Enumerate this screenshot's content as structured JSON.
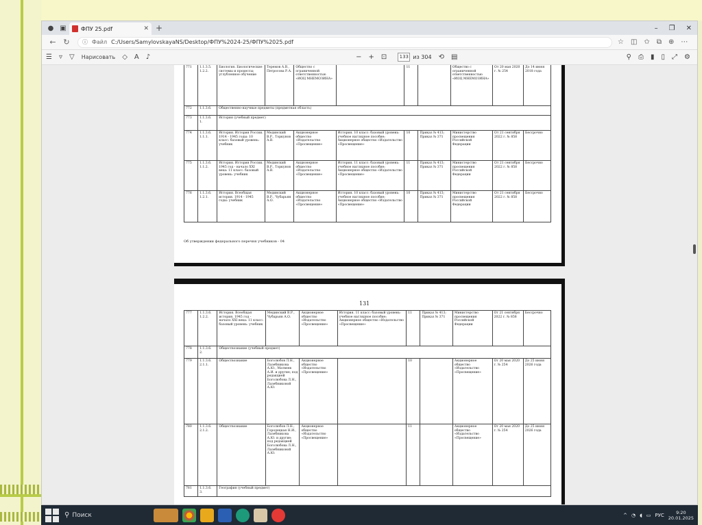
{
  "browser": {
    "tab_title": "ФПУ 25.pdf",
    "new_tab_label": "+",
    "address_label": "Файл",
    "url": "C:/Users/SamylovskayaNS/Desktop/ФПУ%2024-25/ФПУ%2025.pdf"
  },
  "pdf_toolbar": {
    "draw_label": "Нарисовать",
    "page_current": "133",
    "page_total": "из 304"
  },
  "page1": {
    "rows": [
      [
        "771",
        "1.1.3.5. 1.2.2.",
        "Биология. Биологические системы и процессы; углубленное обучение",
        "Теремов А.В., Петросова Р.А.",
        "Общество с ограниченной ответственностью «ИОЦ МНЕМОЗИНА»",
        "",
        "11",
        "",
        "Общество с ограниченной ответственностью «ИОЦ МНЕМОЗИНА»",
        "От 20 мая 2020 г. № 254",
        "До 14 июня 2018 года"
      ],
      [
        "772",
        "1.1.3.6.",
        "Общественно-научные предметы (предметная область)"
      ],
      [
        "773",
        "1.1.3.6. 1.",
        "История (учебный предмет)"
      ],
      [
        "774",
        "1.1.3.6. 1.1.1.",
        "История. История России. 1914 - 1945 годы: 10 класс: базовый уровень: учебник",
        "Мединский В.Р., Торкунов А.В.",
        "Акционерное общество «Издательство «Просвещение»",
        "История. 10 класс: базовый уровень: учебное наглядное пособие; Акционерное общество «Издательство «Просвещение»",
        "10",
        "Приказ № 413; Приказ № 371",
        "Министерство просвещения Российской Федерации",
        "От 21 сентября 2022 г. № 858",
        "Бессрочно"
      ],
      [
        "775",
        "1.1.3.6. 1.1.2.",
        "История. История России. 1945 год - начало XXI века: 11 класс: базовый уровень: учебник",
        "Мединский В.Р., Торкунов А.В.",
        "Акционерное общество «Издательство «Просвещение»",
        "История. 11 класс: базовый уровень: учебное наглядное пособие; Акционерное общество «Издательство «Просвещение»",
        "11",
        "Приказ № 413; Приказ № 371",
        "Министерство просвещения Российской Федерации",
        "От 21 сентября 2022 г. № 858",
        "Бессрочно"
      ],
      [
        "776",
        "1.1.3.6. 1.2.1.",
        "История. Всеобщая история. 1914 - 1945 годы: учебник",
        "Мединский В.Р., Чубарьян А.О.",
        "Акционерное общество «Издательство «Просвещение»",
        "История. 10 класс: базовый уровень: учебное наглядное пособие; Акционерное общество «Издательство «Просвещение»",
        "10",
        "Приказ № 413; Приказ № 371",
        "Министерство просвещения Российской Федерации",
        "От 21 сентября 2022 г. № 858",
        "Бессрочно"
      ]
    ],
    "footer_note": "Об утверждении федерального перечня учебников - 04"
  },
  "page2": {
    "page_number": "131",
    "rows": [
      [
        "777",
        "1.1.3.6. 1.2.2.",
        "История. Всеобщая история. 1945 год - начало XXI века: 11 класс: базовый уровень: учебник",
        "Мединский В.Р., Чубарьян А.О.",
        "Акционерное общество «Издательство «Просвещение»",
        "История. 11 класс: базовый уровень: учебное наглядное пособие; Акционерное общество «Издательство «Просвещение»",
        "11",
        "Приказ № 413; Приказ № 371",
        "Министерство просвещения Российской Федерации",
        "От 21 сентября 2022 г. № 858",
        "Бессрочно"
      ],
      [
        "778",
        "1.1.3.6. 2.",
        "Обществознание (учебный предмет)"
      ],
      [
        "779",
        "1.1.3.6. 2.1.1.",
        "Обществознание",
        "Боголюбов Л.Н., Лазебникова А.Ю., Матвеев А.И. и другие; под редакцией Боголюбова Л.Н., Лазебниковой А.Ю.",
        "Акционерное общество «Издательство «Просвещение»",
        "",
        "10",
        "",
        "Акционерное общество «Издательство «Просвещение»",
        "От 20 мая 2020 г. № 254",
        "До 25 июня 2026 года"
      ],
      [
        "780",
        "1.1.3.6. 2.1.2.",
        "Обществознание",
        "Боголюбов Л.Н., Городецкая Н.И., Лазебникова А.Ю. и другие; под редакцией Боголюбова Л.Н., Лазебниковой А.Ю.",
        "Акционерное общество «Издательство «Просвещение»",
        "",
        "11",
        "",
        "Акционерное общество «Издательство «Просвещение»",
        "От 20 мая 2020 г. № 254",
        "До 25 июня 2026 года"
      ],
      [
        "781",
        "1.1.3.6. 3.",
        "География (учебный предмет)"
      ]
    ]
  },
  "taskbar": {
    "search_label": "Поиск",
    "lang": "РУС",
    "time": "9:20",
    "date": "20.01.2025"
  },
  "colors": {
    "slide_background": "#f4f6d2",
    "stripe": "#b8cc48",
    "taskbar": "#1f2a35",
    "pdf_icon": "#d0312d"
  }
}
